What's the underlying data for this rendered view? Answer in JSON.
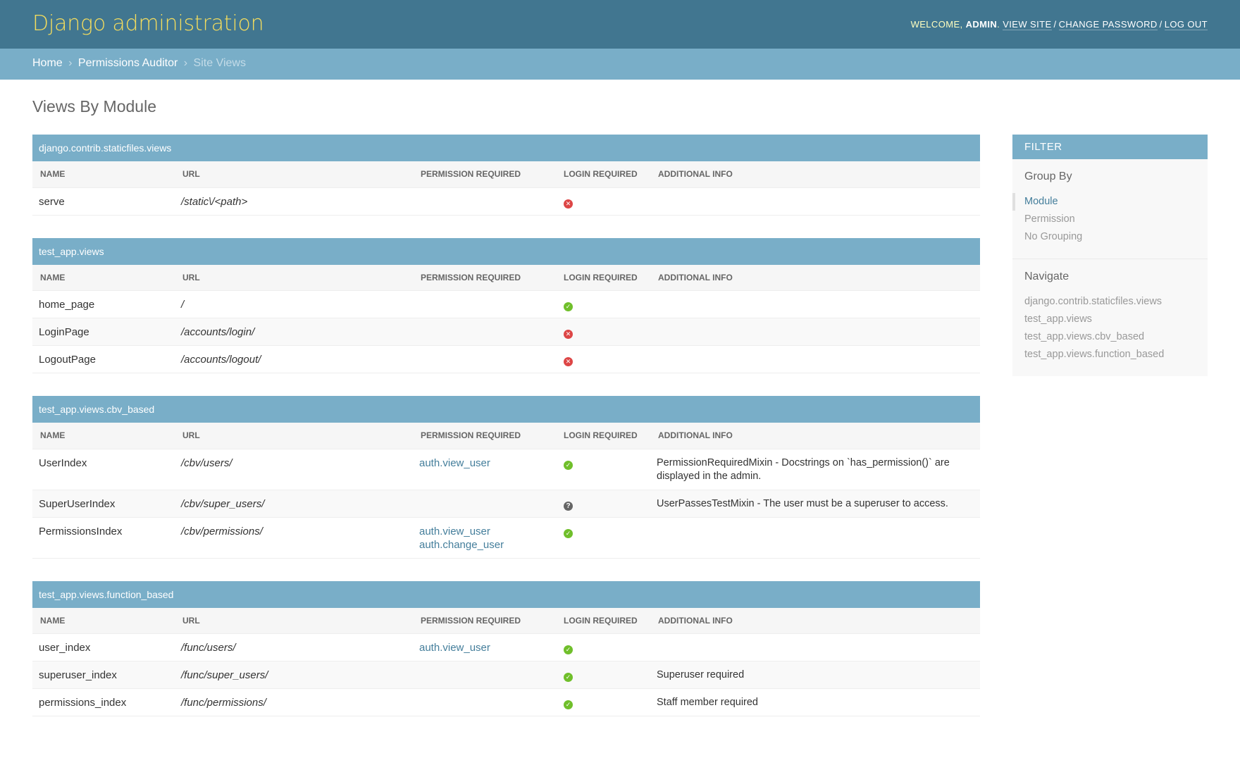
{
  "header": {
    "branding": "Django administration",
    "welcome": "Welcome,",
    "username": "admin",
    "view_site": "View site",
    "change_password": "Change password",
    "log_out": "Log out"
  },
  "breadcrumbs": {
    "home": "Home",
    "app": "Permissions Auditor",
    "current": "Site Views",
    "separator": "›"
  },
  "page_title": "Views By Module",
  "columns": {
    "name": "Name",
    "url": "URL",
    "permission": "Permission Required",
    "login": "Login Required",
    "info": "Additional Info"
  },
  "modules": [
    {
      "name": "django.contrib.staticfiles.views",
      "rows": [
        {
          "name": "serve",
          "url": "/static\\/<path>",
          "permissions": [],
          "login": "no",
          "info": ""
        }
      ]
    },
    {
      "name": "test_app.views",
      "rows": [
        {
          "name": "home_page",
          "url": "/",
          "permissions": [],
          "login": "yes",
          "info": ""
        },
        {
          "name": "LoginPage",
          "url": "/accounts/login/",
          "permissions": [],
          "login": "no",
          "info": ""
        },
        {
          "name": "LogoutPage",
          "url": "/accounts/logout/",
          "permissions": [],
          "login": "no",
          "info": ""
        }
      ]
    },
    {
      "name": "test_app.views.cbv_based",
      "rows": [
        {
          "name": "UserIndex",
          "url": "/cbv/users/",
          "permissions": [
            "auth.view_user"
          ],
          "login": "yes",
          "info": "PermissionRequiredMixin - Docstrings on `has_permission()` are displayed in the admin."
        },
        {
          "name": "SuperUserIndex",
          "url": "/cbv/super_users/",
          "permissions": [],
          "login": "unknown",
          "info": "UserPassesTestMixin - The user must be a superuser to access."
        },
        {
          "name": "PermissionsIndex",
          "url": "/cbv/permissions/",
          "permissions": [
            "auth.view_user",
            "auth.change_user"
          ],
          "login": "yes",
          "info": ""
        }
      ]
    },
    {
      "name": "test_app.views.function_based",
      "rows": [
        {
          "name": "user_index",
          "url": "/func/users/",
          "permissions": [
            "auth.view_user"
          ],
          "login": "yes",
          "info": ""
        },
        {
          "name": "superuser_index",
          "url": "/func/super_users/",
          "permissions": [],
          "login": "yes",
          "info": "Superuser required"
        },
        {
          "name": "permissions_index",
          "url": "/func/permissions/",
          "permissions": [],
          "login": "yes",
          "info": "Staff member required"
        }
      ]
    }
  ],
  "filter": {
    "title": "Filter",
    "group_by": {
      "heading": "Group By",
      "options": [
        {
          "label": "Module",
          "selected": true
        },
        {
          "label": "Permission",
          "selected": false
        },
        {
          "label": "No Grouping",
          "selected": false
        }
      ]
    },
    "navigate": {
      "heading": "Navigate",
      "links": [
        "django.contrib.staticfiles.views",
        "test_app.views",
        "test_app.views.cbv_based",
        "test_app.views.function_based"
      ]
    }
  },
  "colors": {
    "header_bg": "#417690",
    "branding": "#f5dd5d",
    "breadcrumb_bg": "#79aec8",
    "caption_bg": "#79aec8",
    "link": "#447e9b",
    "status_yes": "#70bf2b",
    "status_no": "#dd4646",
    "status_unknown": "#666666"
  },
  "icons": {
    "yes": "check-circle-icon",
    "no": "x-circle-icon",
    "unknown": "question-circle-icon"
  }
}
